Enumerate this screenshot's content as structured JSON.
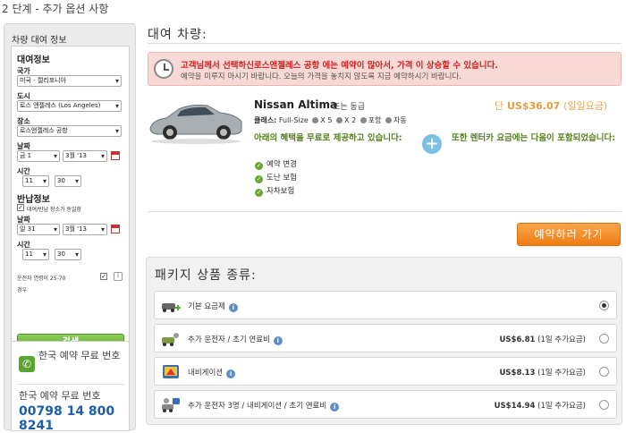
{
  "step_title": "2 단계 - 추가 옵션 사항",
  "sidebar": {
    "header": "차량 대여 정보",
    "rental_section": "대여정보",
    "country_label": "국가",
    "country_value": "미국 - 캘리포니아",
    "city_label": "도시",
    "city_value": "로스 앤젤레스 (Los Angeles)",
    "location_label": "장소",
    "location_value": "로스앤젤레스 공항",
    "date_label": "날짜",
    "pickup_day": "금 1",
    "pickup_month": "3월 '13",
    "time_label": "시간",
    "pickup_hour": "11",
    "pickup_min": "30",
    "return_section": "반납정보",
    "same_place_label": "대여/반납 장소가 동일함",
    "return_date_label": "날짜",
    "return_day": "일 31",
    "return_month": "3월 '13",
    "return_time_label": "시간",
    "return_hour": "11",
    "return_min": "30",
    "driver_age_label": "운전자 연령이 25-70",
    "driver_age_label2": "경우",
    "search_button": "검색",
    "phone_title": "한국 예약 무료 번호",
    "phone_title2": "한국 예약 무료 번호",
    "phone_number": "00798 14 800 8241"
  },
  "main": {
    "heading": "대여 차량:",
    "alert_line1": "고객님께서 선택하신로스앤젤레스 공항 에는 예약이 많아서, 가격 이 상승할 수 있습니다.",
    "alert_line2": "예약을 미루지 마시기 바랍니다. 오늘의 가격을 놓치지 않도록 지금 예약하시기 바랍니다.",
    "car_name": "Nissan Altima",
    "car_similar": "또는 동급",
    "price_prefix": "단",
    "price": "US$36.07",
    "price_suffix": "(일일요금)",
    "class_label": "클래스:",
    "class_value": "Full-Size",
    "seats": "X 5",
    "bags": "X 2",
    "included1": "포함",
    "transmission": "자동",
    "free_heading": "아래의 혜택을 무료로 제공하고 있습니다:",
    "included_heading": "또한 렌터카 요금에는 다음이 포함되었습니다:",
    "benefits": [
      "예약 변경",
      "도난 보험",
      "자차보험"
    ],
    "book_button": "예약하러 가기",
    "packages_heading": "패키지 상품 종류:",
    "packages": [
      {
        "name": "기본 요금제",
        "price": "",
        "selected": true
      },
      {
        "name": "추가 운전자 / 초기 연료비",
        "price": "US$6.81",
        "unit": "(1일 추가요금)",
        "selected": false
      },
      {
        "name": "내비게이션",
        "price": "US$8.13",
        "unit": "(1일 추가요금)",
        "selected": false
      },
      {
        "name": "추가 운전자 3명 / 내비게이션 / 초기 연료비",
        "price": "US$14.94",
        "unit": "(1일 추가요금)",
        "selected": false
      }
    ]
  },
  "colors": {
    "accent_orange": "#ef7c14",
    "search_green": "#5aa530",
    "alert_red": "#cc2222",
    "link_blue": "#1a5fa8"
  }
}
